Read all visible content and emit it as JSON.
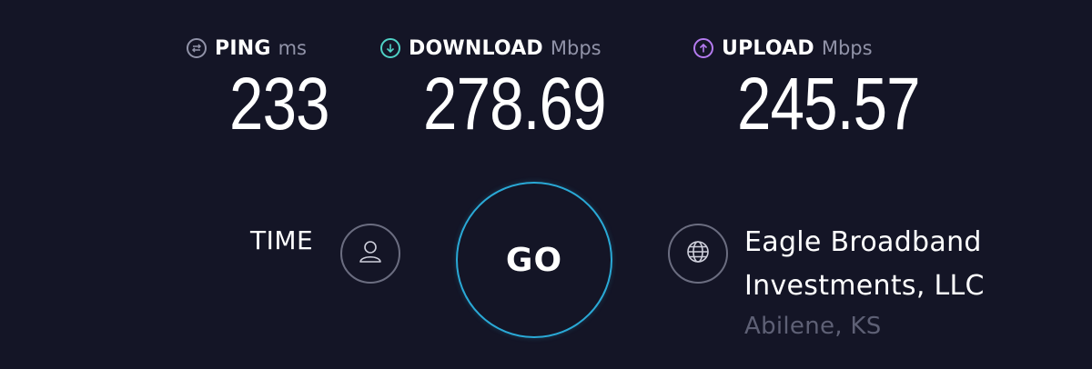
{
  "metrics": {
    "ping": {
      "label": "PING",
      "unit": "ms",
      "value": "233",
      "icon": "ping-icon",
      "color": "#9193a8"
    },
    "download": {
      "label": "DOWNLOAD",
      "unit": "Mbps",
      "value": "278.69",
      "icon": "download-arrow-icon",
      "color": "#4fd1c5"
    },
    "upload": {
      "label": "UPLOAD",
      "unit": "Mbps",
      "value": "245.57",
      "icon": "upload-arrow-icon",
      "color": "#b57bf0"
    }
  },
  "time": {
    "label": "TIME",
    "icon": "user-icon"
  },
  "go_button": {
    "label": "GO",
    "ring_color": "#2aa9d6"
  },
  "server": {
    "icon": "globe-icon",
    "isp_line1": "Eagle Broadband",
    "isp_line2": "Investments, LLC",
    "location": "Abilene, KS"
  },
  "theme": {
    "background": "#141526"
  }
}
